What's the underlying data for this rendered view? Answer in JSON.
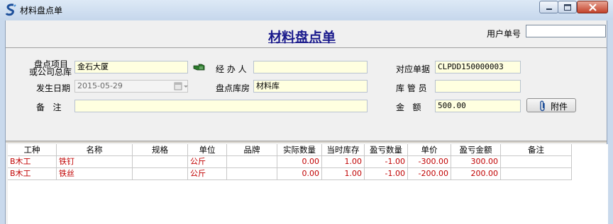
{
  "window": {
    "title": "材料盘点单"
  },
  "form": {
    "title": "材料盘点单",
    "user_doc_label": "用户单号",
    "user_doc_value": "",
    "project_label_line1": "盘点项目",
    "project_label_line2": "或公司总库",
    "project_value": "金石大厦",
    "handler_label": "经 办 人",
    "handler_value": "",
    "ref_doc_label": "对应单据",
    "ref_doc_value": "CLPDD150000003",
    "date_label": "发生日期",
    "date_value": "2015-05-29",
    "warehouse_label": "盘点库房",
    "warehouse_value": "材料库",
    "keeper_label": "库 管 员",
    "keeper_value": "",
    "remark_label": "备   注",
    "remark_value": "",
    "amount_label": "金   额",
    "amount_value": "500.00",
    "attach_label": "附件"
  },
  "table": {
    "columns": [
      "工种",
      "名称",
      "规格",
      "单位",
      "品牌",
      "实际数量",
      "当时库存",
      "盈亏数量",
      "单价",
      "盈亏金额",
      "备注"
    ],
    "rows": [
      [
        "B木工",
        "铁钉",
        "",
        "公斤",
        "",
        "0.00",
        "1.00",
        "-1.00",
        "-300.00",
        "300.00",
        ""
      ],
      [
        "B木工",
        "铁丝",
        "",
        "公斤",
        "",
        "0.00",
        "1.00",
        "-1.00",
        "-200.00",
        "200.00",
        ""
      ]
    ]
  },
  "colors": {
    "title_blue": "#1a1a8c",
    "row_red": "#c00000",
    "field_yellow": "#ffffe0"
  }
}
